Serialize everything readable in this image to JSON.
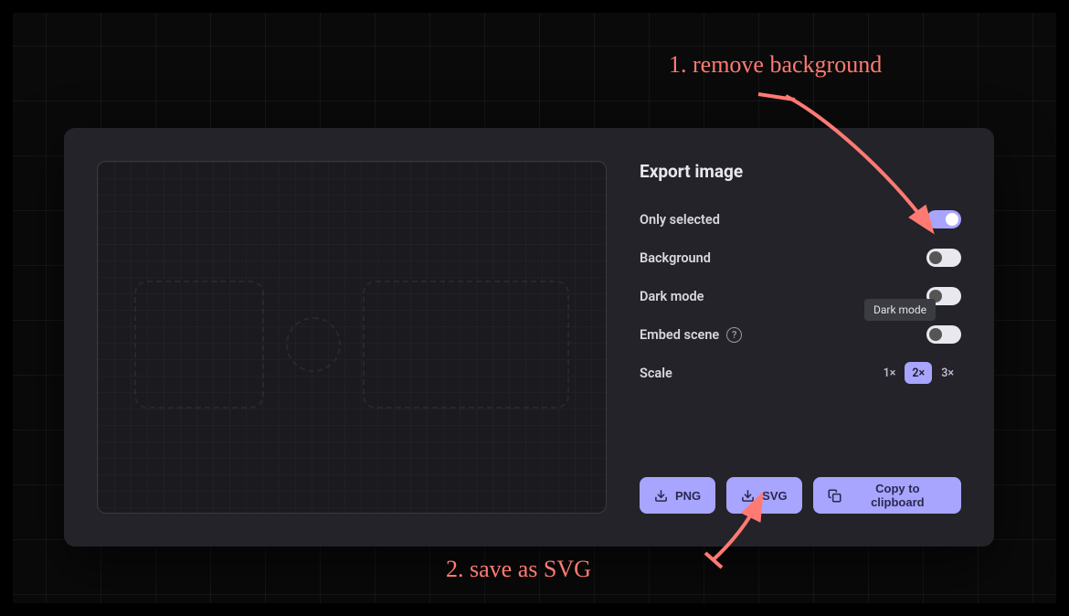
{
  "dialog": {
    "title": "Export image",
    "options": {
      "only_selected": {
        "label": "Only selected",
        "on": true
      },
      "background": {
        "label": "Background",
        "on": false
      },
      "dark_mode": {
        "label": "Dark mode",
        "on": false
      },
      "embed_scene": {
        "label": "Embed scene",
        "on": false
      }
    },
    "scale": {
      "label": "Scale",
      "options": [
        "1×",
        "2×",
        "3×"
      ],
      "active": "2×"
    },
    "tooltip": "Dark mode",
    "actions": {
      "png": "PNG",
      "svg": "SVG",
      "copy": "Copy to clipboard"
    }
  },
  "annotations": {
    "step1": "1. remove background",
    "step2": "2. save as SVG"
  },
  "colors": {
    "accent": "#a8a5ff",
    "annotation": "#ff7a72",
    "panel": "#232329"
  }
}
